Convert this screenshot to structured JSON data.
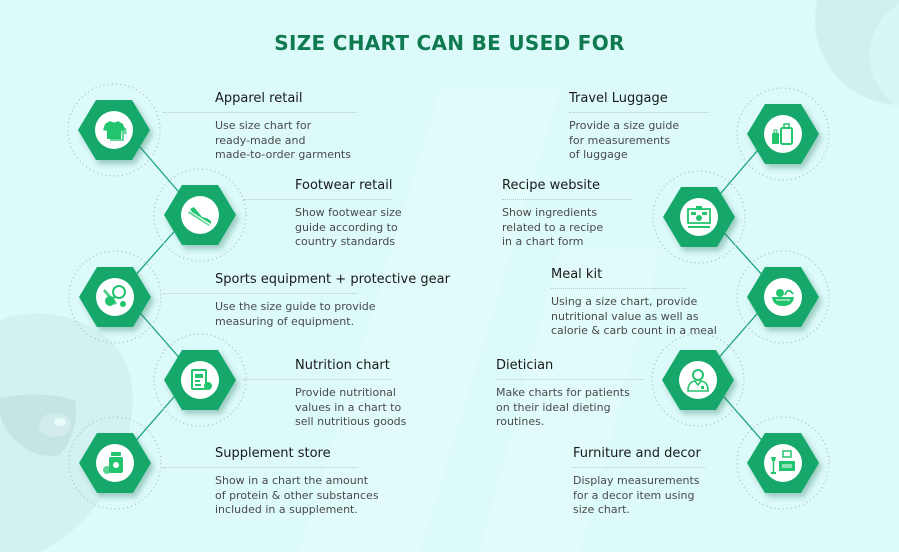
{
  "title": "SIZE CHART CAN BE USED FOR",
  "colors": {
    "background": "#dcfafa",
    "hexagon": "#17a86b",
    "hexagon_dark": "#0f8f5a",
    "icon": "#22c46e",
    "title": "#0f7a4f",
    "connector": "#1aa47a"
  },
  "left_items": [
    {
      "title": "Apparel retail",
      "description": "Use size chart for\nready-made and\nmade-to-order garments",
      "icon": "tshirt-icon"
    },
    {
      "title": "Footwear retail",
      "description": "Show footwear size\nguide according to\ncountry standards",
      "icon": "shoe-icon"
    },
    {
      "title": "Sports equipment + protective gear",
      "description": "Use the size guide to provide\nmeasuring of equipment.",
      "icon": "sports-equipment-icon"
    },
    {
      "title": "Nutrition chart",
      "description": "Provide nutritional\nvalues in a chart to\nsell nutritious goods",
      "icon": "clipboard-chart-icon"
    },
    {
      "title": "Supplement store",
      "description": "Show in a chart the amount\nof protein & other substances\nincluded in a supplement.",
      "icon": "supplement-jar-icon"
    }
  ],
  "right_items": [
    {
      "title": "Travel Luggage",
      "description": "Provide a size guide\nfor measurements\nof luggage",
      "icon": "luggage-icon"
    },
    {
      "title": "Recipe website",
      "description": "Show ingredients\nrelated to a recipe\nin a chart form",
      "icon": "recipe-screen-icon"
    },
    {
      "title": "Meal kit",
      "description": "Using a size chart, provide\nnutritional value as well as\ncalorie & carb count in a meal",
      "icon": "meal-bowl-icon"
    },
    {
      "title": "Dietician",
      "description": "Make charts for patients\non their ideal dieting\nroutines.",
      "icon": "dietician-icon"
    },
    {
      "title": "Furniture and decor",
      "description": "Display measurements\nfor a decor item using\nsize chart.",
      "icon": "furniture-icon"
    }
  ]
}
